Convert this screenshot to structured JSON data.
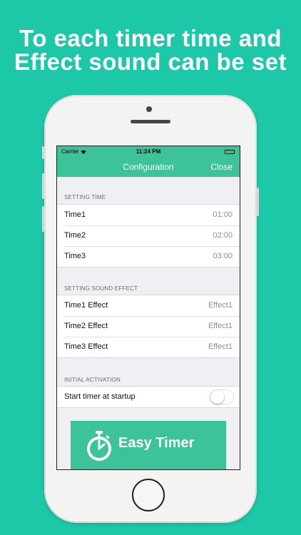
{
  "headline": {
    "line1": "To each timer time and",
    "line2": "Effect sound can be set"
  },
  "status_bar": {
    "carrier": "Carrier",
    "time": "11:24 PM"
  },
  "nav": {
    "title": "Configuration",
    "close_label": "Close"
  },
  "sections": {
    "time": {
      "header": "SETTING TIME",
      "rows": [
        {
          "label": "Time1",
          "value": "01:00"
        },
        {
          "label": "Time2",
          "value": "02:00"
        },
        {
          "label": "Time3",
          "value": "03:00"
        }
      ]
    },
    "sound": {
      "header": "SETTING SOUND EFFECT",
      "rows": [
        {
          "label": "Time1 Effect",
          "value": "Effect1"
        },
        {
          "label": "Time2 Effect",
          "value": "Effect1"
        },
        {
          "label": "Time3 Effect",
          "value": "Effect1"
        }
      ]
    },
    "activation": {
      "header": "INITIAL ACTIVATION",
      "rows": [
        {
          "label": "Start timer at startup",
          "toggle_on": false
        }
      ]
    }
  },
  "banner": {
    "label": "Easy Timer",
    "icon": "stopwatch-icon"
  },
  "colors": {
    "background": "#1dc8a8",
    "accent": "#3cc39a"
  }
}
